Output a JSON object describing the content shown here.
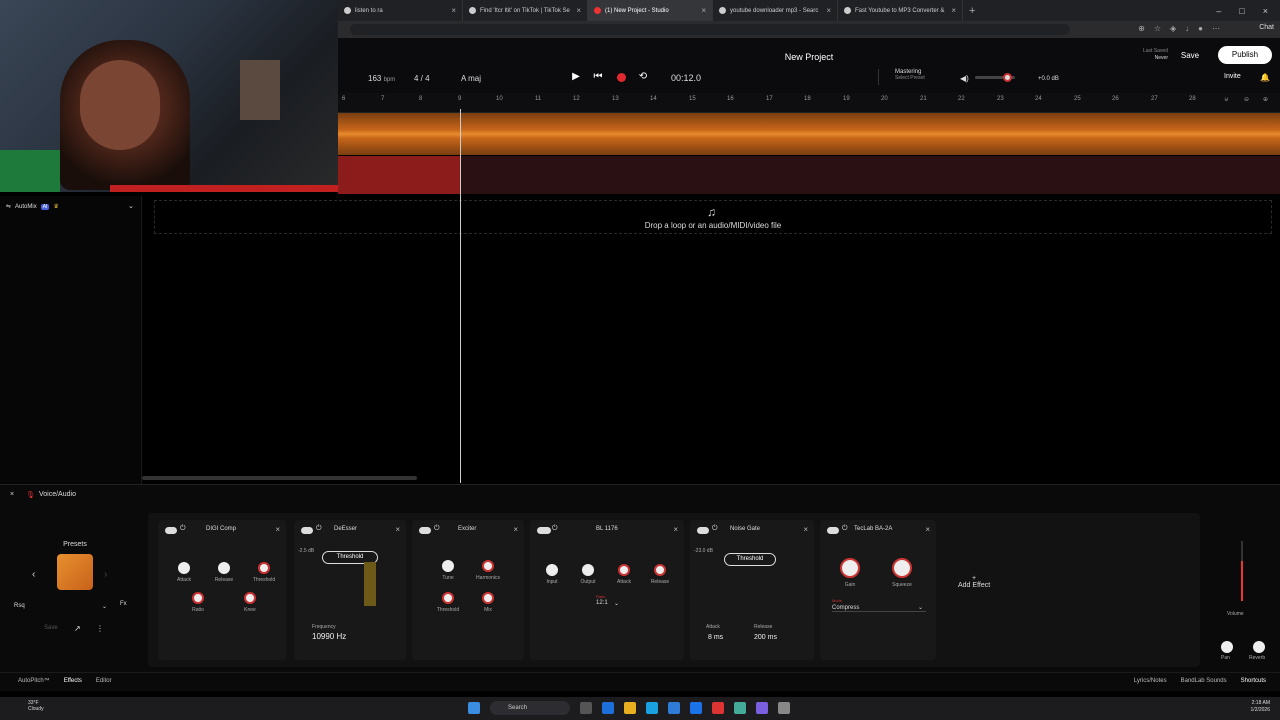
{
  "browser": {
    "tabs": [
      {
        "title": "listen to ra",
        "active": false
      },
      {
        "title": "Find 'Itcr Itit' on TikTok | TikTok Se",
        "active": false
      },
      {
        "title": "(1) New Project - Studio",
        "active": true
      },
      {
        "title": "youtube downloader mp3 - Searc",
        "active": false
      },
      {
        "title": "Fast Youtube to MP3 Converter &",
        "active": false
      }
    ],
    "new_tab": "+",
    "chat_label": "Chat"
  },
  "studio": {
    "project_title": "New Project",
    "bpm": "163",
    "bpm_unit": "bpm",
    "time_signature": "4 / 4",
    "key": "A maj",
    "time": "00:12.0",
    "mastering_label": "Mastering",
    "mastering_sub": "Select Preset",
    "volume_db": "+0.0 dB",
    "last_saved_label": "Last Saved",
    "last_saved_value": "Never",
    "save_label": "Save",
    "publish_label": "Publish",
    "invite_label": "Invite"
  },
  "ruler": [
    "6",
    "7",
    "8",
    "9",
    "10",
    "11",
    "12",
    "13",
    "14",
    "15",
    "16",
    "17",
    "18",
    "19",
    "20",
    "21",
    "22",
    "23",
    "24",
    "25",
    "26",
    "27",
    "28"
  ],
  "track_panel": {
    "name": "AutoMix",
    "badge": "AI"
  },
  "dropzone": {
    "text": "Drop a loop or an audio/MIDI/video file"
  },
  "bottom": {
    "track_name": "Voice/Audio",
    "presets_label": "Presets",
    "preset_name": "Rsq",
    "save_label": "Save",
    "effects": [
      {
        "name": "DIGI Comp",
        "knobs": [
          "Attack",
          "Release",
          "Threshold",
          "Ratio",
          "Knee"
        ]
      },
      {
        "name": "DeEsser",
        "threshold": "Threshold",
        "db": "-2.5 dB",
        "freq_label": "Frequency",
        "freq_value": "10990 Hz"
      },
      {
        "name": "Exciter",
        "knobs": [
          "Tune",
          "Harmonics",
          "Threshold",
          "Mix"
        ]
      },
      {
        "name": "BL 1176",
        "knobs": [
          "Input",
          "Output",
          "Attack",
          "Release"
        ],
        "ratio_label": "Ratio",
        "ratio_value": "12:1"
      },
      {
        "name": "Noise Gate",
        "threshold": "Threshold",
        "db": "-23.0 dB",
        "attack_label": "Attack",
        "attack_value": "8 ms",
        "release_label": "Release",
        "release_value": "200 ms"
      },
      {
        "name": "TecLab BA-2A",
        "knobs": [
          "Gain",
          "Squeeze"
        ],
        "mode_label": "Mode",
        "mode_value": "Compress"
      }
    ],
    "add_effect": "Add Effect",
    "mixer": {
      "volume": "Volume",
      "pan": "Pan",
      "reverb": "Reverb"
    }
  },
  "status": {
    "autopitch": "AutoPitch™",
    "effects": "Effects",
    "editor": "Editor",
    "lyrics": "Lyrics/Notes",
    "sounds": "BandLab Sounds",
    "shortcuts": "Shortcuts"
  },
  "taskbar": {
    "temp": "33°F",
    "weather": "Cloudy",
    "search": "Search",
    "time": "2:18 AM",
    "date": "1/2/2026"
  }
}
